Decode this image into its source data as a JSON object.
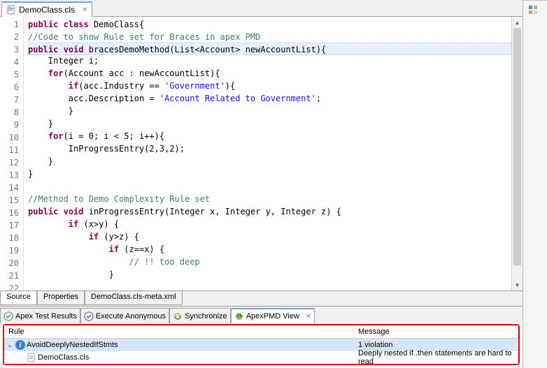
{
  "editor": {
    "file_tab_label": "DemoClass.cls",
    "lines": [
      {
        "n": 1,
        "cls": "",
        "html": "<span class='kw'>public</span> <span class='kw'>class</span> DemoClass{"
      },
      {
        "n": 2,
        "cls": "",
        "html": "<span class='cmt'>//Code to show Rule set for Braces in apex PMD</span>"
      },
      {
        "n": 3,
        "cls": "hl",
        "html": "<span class='kw'>public</span> <span class='kw'>void</span> bracesDemoMethod(List&lt;Account&gt; newAccountList){"
      },
      {
        "n": 4,
        "cls": "",
        "html": "    Integer i;"
      },
      {
        "n": 5,
        "cls": "",
        "html": "    <span class='kw'>for</span>(Account acc : newAccountList){"
      },
      {
        "n": 6,
        "cls": "",
        "html": "        <span class='kw'>if</span>(acc.Industry == <span class='str'>'Government'</span>){"
      },
      {
        "n": 7,
        "cls": "",
        "html": "        acc.Description = <span class='str'>'Account Related to Government'</span>;"
      },
      {
        "n": 8,
        "cls": "",
        "html": "        }"
      },
      {
        "n": 9,
        "cls": "",
        "html": "    }"
      },
      {
        "n": 10,
        "cls": "",
        "html": "    <span class='kw'>for</span>(i = 0; i &lt; 5; i++){"
      },
      {
        "n": 11,
        "cls": "",
        "html": "        InProgressEntry(2,3,2);"
      },
      {
        "n": 12,
        "cls": "",
        "html": "    }"
      },
      {
        "n": 13,
        "cls": "",
        "html": "}"
      },
      {
        "n": 14,
        "cls": "",
        "html": ""
      },
      {
        "n": 15,
        "cls": "",
        "html": "<span class='cmt'>//Method to Demo Complexity Rule set</span>"
      },
      {
        "n": 16,
        "cls": "",
        "html": "<span class='kw'>public</span> <span class='kw'>void</span> inProgressEntry(Integer x, Integer y, Integer z) {"
      },
      {
        "n": 17,
        "cls": "",
        "html": "        <span class='kw'>if</span> (x&gt;y) {"
      },
      {
        "n": 18,
        "cls": "",
        "html": "            <span class='kw'>if</span> (y&gt;z) {"
      },
      {
        "n": 19,
        "cls": "",
        "html": "                <span class='kw'>if</span> (z==x) {"
      },
      {
        "n": 20,
        "cls": "",
        "html": "                    <span class='cmt'>// !! too deep</span>"
      },
      {
        "n": 21,
        "cls": "",
        "html": "                }"
      },
      {
        "n": 22,
        "cls": "",
        "html": "            <span style='visibility:hidden'>}</span>"
      }
    ],
    "bottom_tabs": [
      "Source",
      "Properties",
      "DemoClass.cls-meta.xml"
    ],
    "bottom_active": "Source"
  },
  "panel": {
    "tabs": [
      {
        "label": "Apex Test Results",
        "icon": "check"
      },
      {
        "label": "Execute Anonymous",
        "icon": "terminal"
      },
      {
        "label": "Synchronize",
        "icon": "sync"
      },
      {
        "label": "ApexPMD View",
        "icon": "pmd",
        "active": true
      }
    ]
  },
  "violations": {
    "columns": {
      "rule": "Rule",
      "message": "Message"
    },
    "rows": [
      {
        "kind": "group",
        "label": "AvoidDeeplyNestedIfStmts",
        "msg": "1 violation",
        "selected": true
      },
      {
        "kind": "item",
        "label": "DemoClass.cls",
        "msg": "Deeply nested if..then statements are hard to read"
      }
    ]
  }
}
